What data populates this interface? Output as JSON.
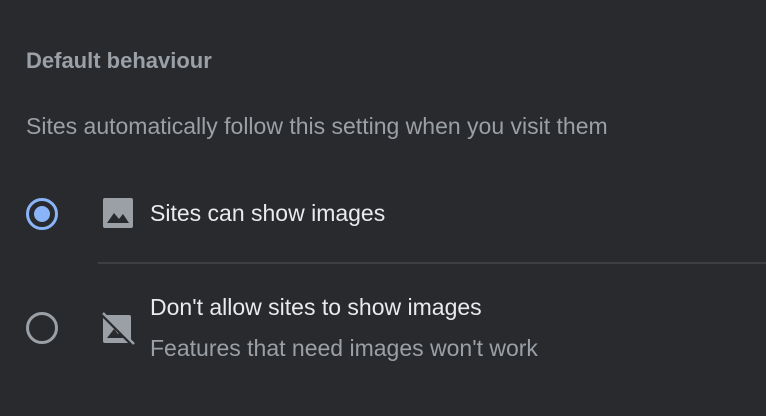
{
  "section": {
    "title": "Default behaviour",
    "description": "Sites automatically follow this setting when you visit them"
  },
  "options": [
    {
      "label": "Sites can show images",
      "sublabel": "",
      "icon": "image-icon",
      "selected": true
    },
    {
      "label": "Don't allow sites to show images",
      "sublabel": "Features that need images won't work",
      "icon": "image-blocked-icon",
      "selected": false
    }
  ],
  "colors": {
    "background": "#292a2d",
    "accent": "#8ab4f8",
    "primary_text": "#e8eaed",
    "secondary_text": "#9aa0a6",
    "divider": "#3c4043"
  }
}
